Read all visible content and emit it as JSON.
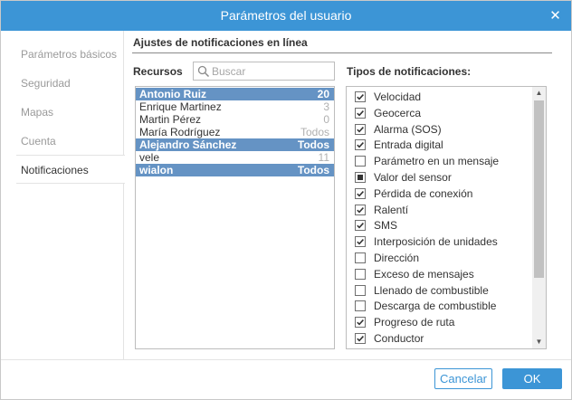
{
  "dialog": {
    "title": "Parámetros del usuario"
  },
  "sidebar": {
    "items": [
      {
        "label": "Parámetros básicos",
        "active": false
      },
      {
        "label": "Seguridad",
        "active": false
      },
      {
        "label": "Mapas",
        "active": false
      },
      {
        "label": "Cuenta",
        "active": false
      },
      {
        "label": "Notificaciones",
        "active": true
      }
    ]
  },
  "section": {
    "title": "Ajustes de notificaciones en línea"
  },
  "resources": {
    "label": "Recursos",
    "search_placeholder": "Buscar",
    "search_value": "",
    "rows": [
      {
        "name": "Antonio Ruiz",
        "count": "20",
        "selected": true
      },
      {
        "name": "Enrique Martinez",
        "count": "3",
        "selected": false
      },
      {
        "name": "Martin Pérez",
        "count": "0",
        "selected": false
      },
      {
        "name": "María Rodríguez",
        "count": "Todos",
        "selected": false
      },
      {
        "name": "Alejandro Sánchez",
        "count": "Todos",
        "selected": true
      },
      {
        "name": "vele",
        "count": "11",
        "selected": false
      },
      {
        "name": "wialon",
        "count": "Todos",
        "selected": true
      }
    ]
  },
  "types": {
    "label": "Tipos de notificaciones:",
    "items": [
      {
        "label": "Velocidad",
        "state": "checked"
      },
      {
        "label": "Geocerca",
        "state": "checked"
      },
      {
        "label": "Alarma (SOS)",
        "state": "checked"
      },
      {
        "label": "Entrada digital",
        "state": "checked"
      },
      {
        "label": "Parámetro en un mensaje",
        "state": "unchecked"
      },
      {
        "label": "Valor del sensor",
        "state": "partial"
      },
      {
        "label": "Pérdida de conexión",
        "state": "checked"
      },
      {
        "label": "Ralentí",
        "state": "checked"
      },
      {
        "label": "SMS",
        "state": "checked"
      },
      {
        "label": "Interposición de unidades",
        "state": "checked"
      },
      {
        "label": "Dirección",
        "state": "unchecked"
      },
      {
        "label": "Exceso de mensajes",
        "state": "unchecked"
      },
      {
        "label": "Llenado de combustible",
        "state": "unchecked"
      },
      {
        "label": "Descarga de combustible",
        "state": "unchecked"
      },
      {
        "label": "Progreso de ruta",
        "state": "checked"
      },
      {
        "label": "Conductor",
        "state": "checked"
      }
    ]
  },
  "footer": {
    "cancel_label": "Cancelar",
    "ok_label": "OK"
  },
  "colors": {
    "accent": "#3c95d6",
    "selection": "#6593c4"
  }
}
